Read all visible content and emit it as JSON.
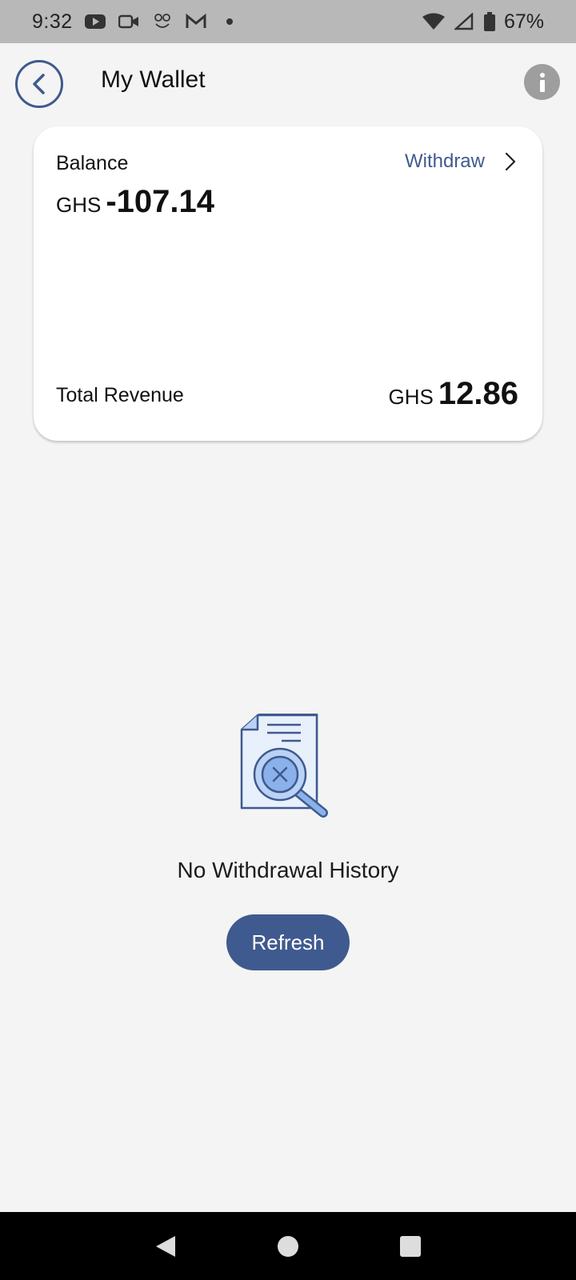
{
  "status_bar": {
    "time": "9:32",
    "battery": "67%",
    "icons": [
      "youtube-icon",
      "video-camera-icon",
      "pets-icon",
      "gmail-icon",
      "dot-icon",
      "wifi-icon",
      "signal-icon",
      "battery-icon"
    ]
  },
  "header": {
    "title": "My Wallet"
  },
  "card": {
    "balance_label": "Balance",
    "withdraw_label": "Withdraw",
    "balance_currency": "GHS",
    "balance_amount": "-107.14",
    "revenue_label": "Total Revenue",
    "revenue_currency": "GHS",
    "revenue_amount": "12.86"
  },
  "empty_state": {
    "message": "No Withdrawal History",
    "refresh_label": "Refresh"
  },
  "colors": {
    "accent": "#3f5a8e",
    "background": "#f4f4f4",
    "illustration_light": "#b9d2f5",
    "illustration_mid": "#8ab1ea"
  }
}
